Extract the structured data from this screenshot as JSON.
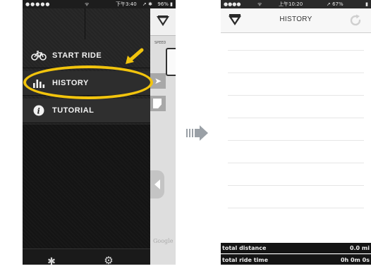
{
  "left_screen": {
    "status_bar": {
      "signal": "●●●●●",
      "wifi": "ᯤ",
      "time": "下午3:40",
      "bluetooth": "➚ ✱",
      "battery": "96% ▮"
    },
    "menu": {
      "items": [
        {
          "label": "START RIDE",
          "icon": "bicycle-icon"
        },
        {
          "label": "HISTORY",
          "icon": "bar-chart-icon"
        },
        {
          "label": "TUTORIAL",
          "icon": "info-icon"
        }
      ]
    },
    "map_peek": {
      "speed_label": "SPEED",
      "google_label": "Google"
    },
    "bottom_bar": {
      "bluetooth_glyph": "✱",
      "settings_glyph": "⚙"
    },
    "annotation_color": "#f2c40d"
  },
  "right_screen": {
    "status_bar": {
      "signal": "●●●●",
      "wifi": "ᯤ",
      "time": "上午10:20",
      "location": "➚ 67%",
      "battery": "▮"
    },
    "header": {
      "title": "HISTORY",
      "refresh_icon": "refresh-icon"
    },
    "list": {
      "row_count": 8
    },
    "summary": {
      "total_distance_label": "total distance",
      "total_distance_value": "0.0 mi",
      "total_ride_time_label": "total ride time",
      "total_ride_time_value": "0h 0m 0s"
    }
  }
}
